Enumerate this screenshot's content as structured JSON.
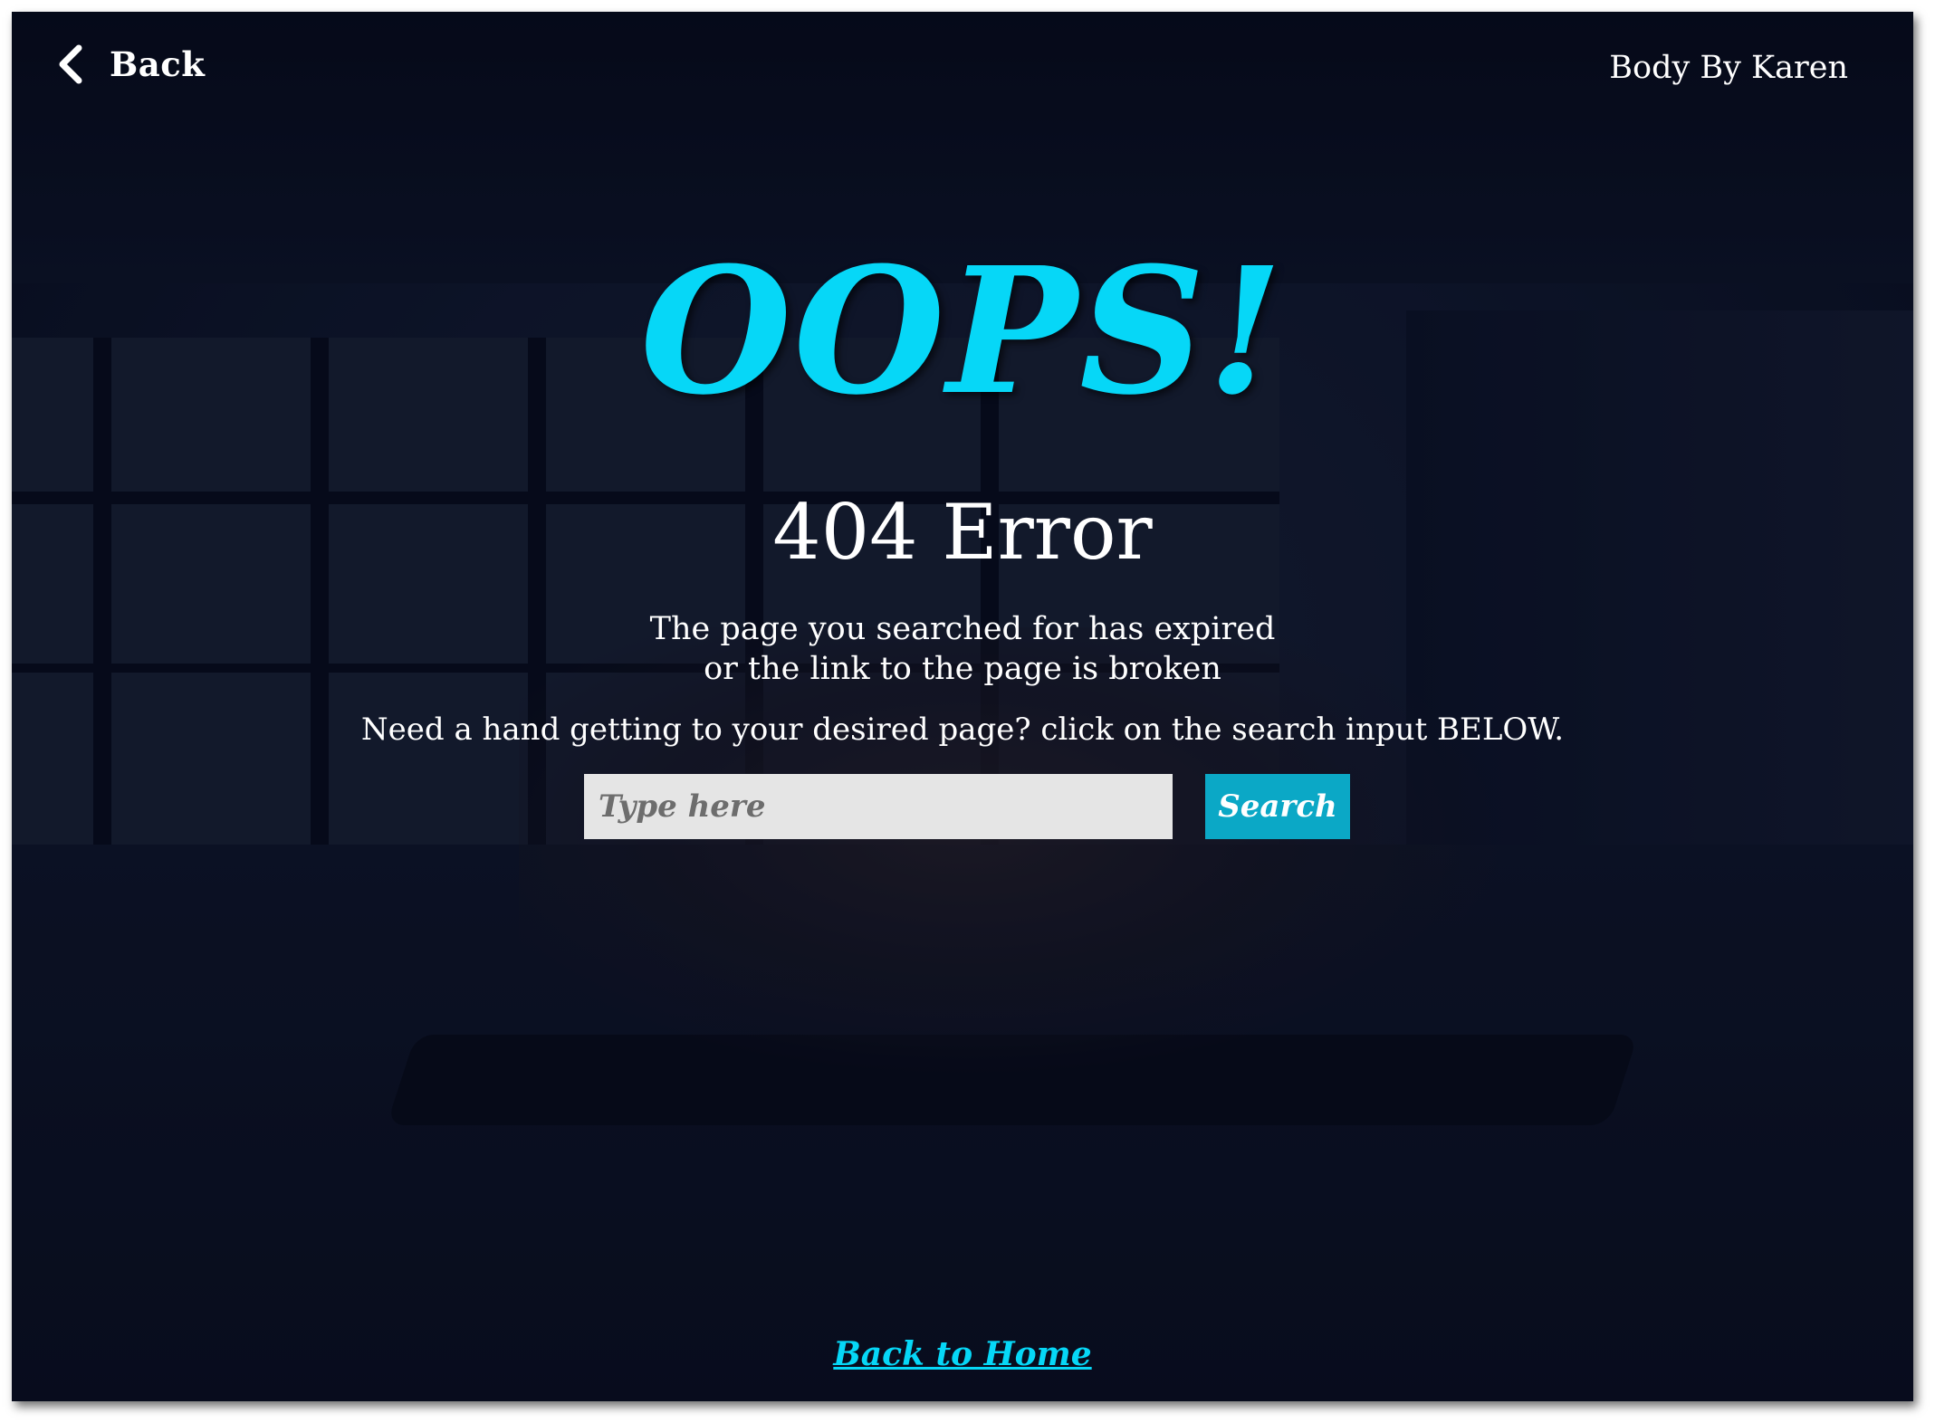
{
  "header": {
    "back_label": "Back",
    "brand": "Body By Karen"
  },
  "hero": {
    "headline": "OOPS!",
    "error_title": "404 Error",
    "description_line1": "The page you searched for has expired",
    "description_line2": "or the link to the page is broken",
    "hint": "Need a hand getting to your desired page? click on the search input BELOW."
  },
  "search": {
    "placeholder": "Type here",
    "value": "",
    "button_label": "Search"
  },
  "footer": {
    "home_link": "Back to Home"
  },
  "icons": {
    "back": "chevron-left-icon"
  },
  "colors": {
    "accent": "#06d7f7",
    "button": "#0ba8c6",
    "background": "#0b1122",
    "input_bg": "#e5e5e5"
  }
}
